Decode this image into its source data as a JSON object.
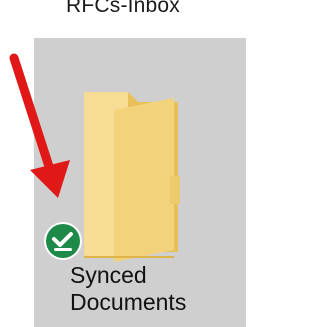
{
  "top_item": {
    "label": "RFCs-Inbox"
  },
  "selected_item": {
    "name_line1": "Synced",
    "name_line2": "Documents",
    "icon": "folder-icon",
    "status": "synced",
    "status_icon": "check-badge-icon"
  },
  "annotation": {
    "icon": "red-arrow-icon"
  },
  "colors": {
    "selection": "#cfcfcf",
    "folder": "#f3d27c",
    "status_badge": "#1e8a49",
    "arrow": "#e01818"
  }
}
